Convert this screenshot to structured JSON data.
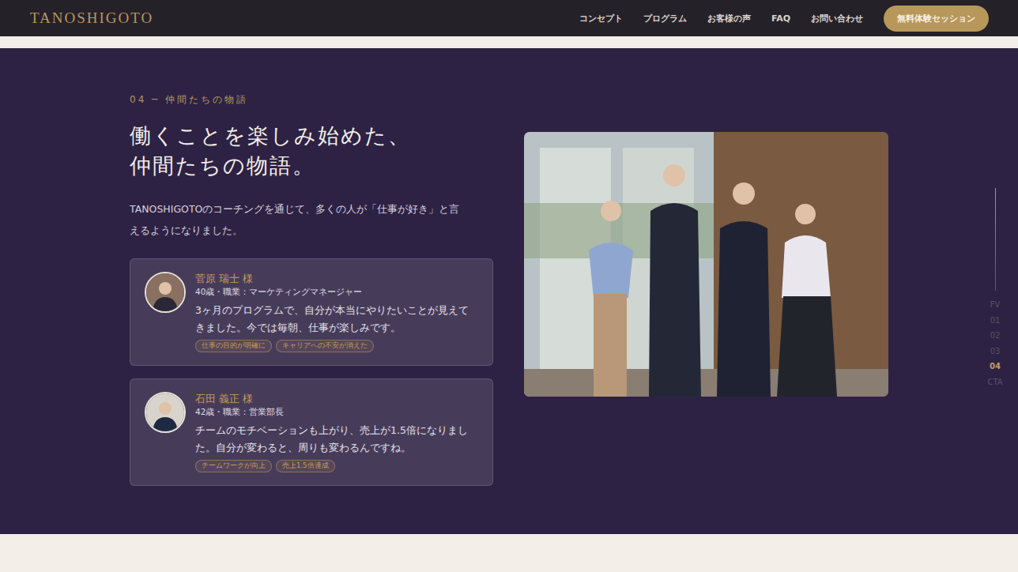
{
  "nav": {
    "logo": "TANOSHIGOTO",
    "links": [
      "コンセプト",
      "プログラム",
      "お客様の声",
      "FAQ",
      "お問い合わせ"
    ],
    "button": "無料体験セッション"
  },
  "section": {
    "label": "04 ─ 仲間たちの物語",
    "heading": [
      "働くことを楽しみ始めた、",
      "仲間たちの物語。"
    ],
    "lead": "TANOSHIGOTOのコーチングを通じて、多くの人が「仕事が好き」と言えるようになりました。"
  },
  "testimonials": [
    {
      "name": "菅原 瑞士 様",
      "meta": "40歳・職業：マーケティングマネージャー",
      "quote": "3ヶ月のプログラムで、自分が本当にやりたいことが見えてきました。今では毎朝、仕事が楽しみです。",
      "tags": [
        "仕事の目的が明確に",
        "キャリアへの不安が消えた"
      ]
    },
    {
      "name": "石田 義正 様",
      "meta": "42歳・職業：営業部長",
      "quote": "チームのモチベーションも上がり、売上が1.5倍になりました。自分が変わると、周りも変わるんですね。",
      "tags": [
        "チームワークが向上",
        "売上1.5倍達成"
      ]
    }
  ],
  "side_nav": [
    {
      "label": "FV",
      "selected": false
    },
    {
      "label": "01",
      "selected": false
    },
    {
      "label": "02",
      "selected": false
    },
    {
      "label": "03",
      "selected": false
    },
    {
      "label": "04",
      "selected": true
    },
    {
      "label": "CTA",
      "selected": false
    }
  ]
}
